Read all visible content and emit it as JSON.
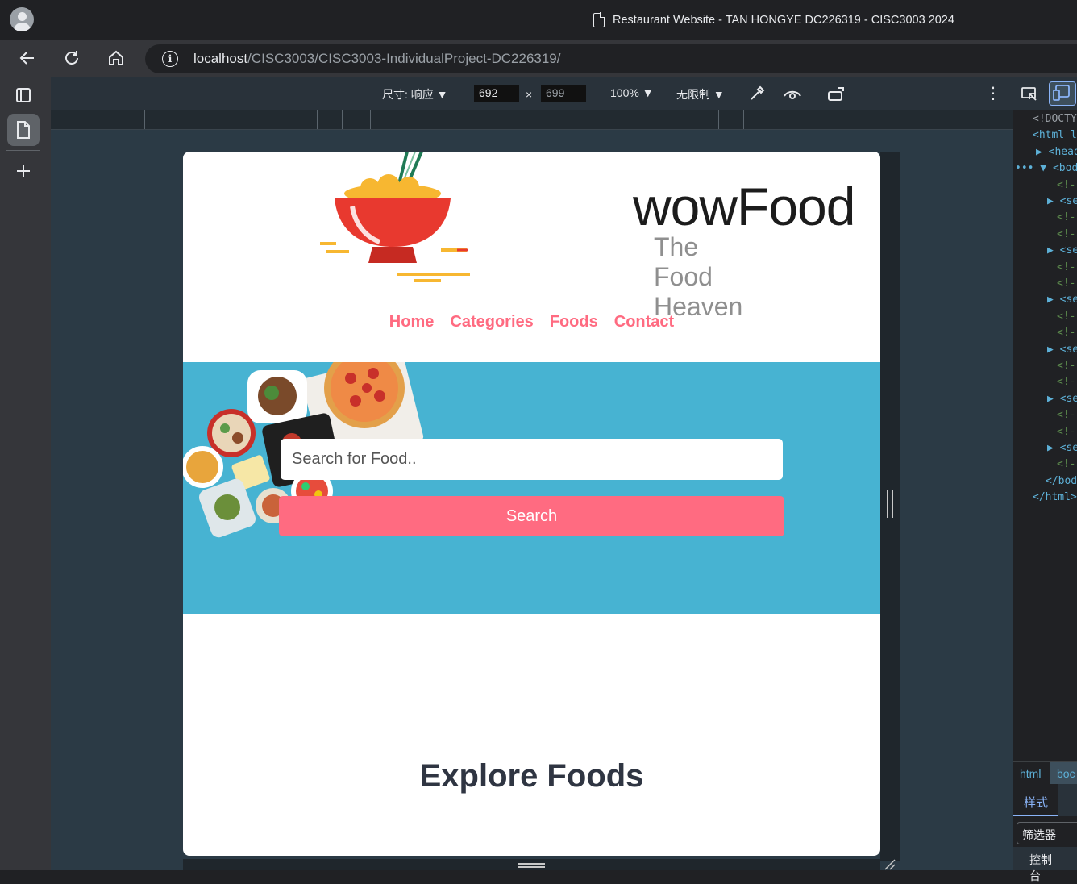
{
  "window": {
    "title": "Restaurant Website - TAN HONGYE DC226319 - CISC3003 2024"
  },
  "address_bar": {
    "host": "localhost",
    "path": "/CISC3003/CISC3003-IndividualProject-DC226319/"
  },
  "device_toolbar": {
    "dimensions_label": "尺寸: 响应",
    "width": "692",
    "times": "×",
    "height": "699",
    "zoom": "100%",
    "throttle": "无限制"
  },
  "site": {
    "logo": {
      "word": "wowFood",
      "tagline": "The Food Heaven"
    },
    "menu": [
      {
        "label": "Home"
      },
      {
        "label": "Categories"
      },
      {
        "label": "Foods"
      },
      {
        "label": "Contact"
      }
    ],
    "search": {
      "placeholder": "Search for Food..",
      "button": "Search"
    },
    "section_heading": "Explore Foods",
    "colors": {
      "accent": "#ff6b81",
      "hero_bg": "#47b3d2",
      "heading": "#2f3542"
    }
  },
  "devtools_panel": {
    "lines": [
      {
        "text": "<!DOCTY",
        "kind": "plain"
      },
      {
        "text": "<html l",
        "kind": "tag"
      },
      {
        "text": "▶ <head",
        "kind": "tag"
      },
      {
        "text": "••• ▼ <body",
        "kind": "tag"
      },
      {
        "text": "<!-",
        "kind": "cmt"
      },
      {
        "text": "▶ <se",
        "kind": "tag"
      },
      {
        "text": "<!-",
        "kind": "cmt"
      },
      {
        "text": "<!-",
        "kind": "cmt"
      },
      {
        "text": "▶ <se",
        "kind": "tag"
      },
      {
        "text": "<!-",
        "kind": "cmt"
      },
      {
        "text": "<!-",
        "kind": "cmt"
      },
      {
        "text": "▶ <se",
        "kind": "tag"
      },
      {
        "text": "<!-",
        "kind": "cmt"
      },
      {
        "text": "<!-",
        "kind": "cmt"
      },
      {
        "text": "▶ <se",
        "kind": "tag"
      },
      {
        "text": "<!-",
        "kind": "cmt"
      },
      {
        "text": "<!-",
        "kind": "cmt"
      },
      {
        "text": "▶ <se",
        "kind": "tag"
      },
      {
        "text": "<!-",
        "kind": "cmt"
      },
      {
        "text": "<!-",
        "kind": "cmt"
      },
      {
        "text": "▶ <se",
        "kind": "tag"
      },
      {
        "text": "<!-",
        "kind": "cmt"
      },
      {
        "text": "</bod",
        "kind": "tag"
      },
      {
        "text": "</html>",
        "kind": "tag"
      }
    ],
    "crumbs": [
      "html",
      "boc"
    ],
    "styles_tab": "样式",
    "filter_placeholder": "筛选器",
    "console_label": "控制台"
  }
}
